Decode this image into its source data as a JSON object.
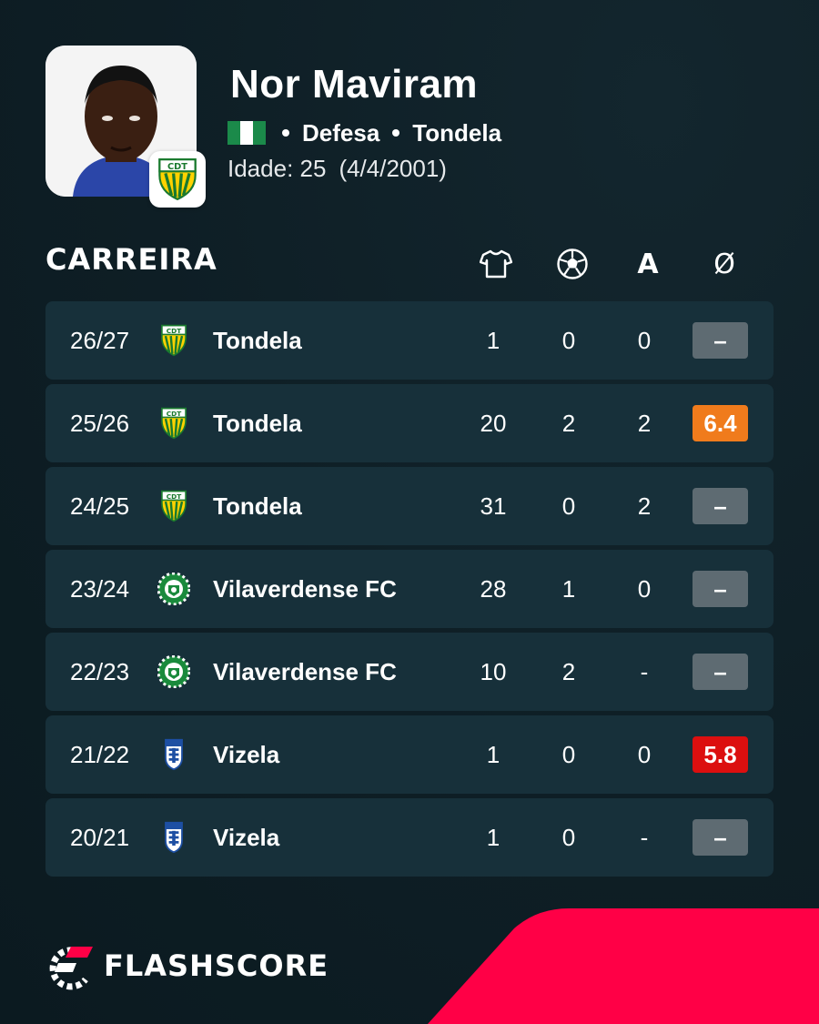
{
  "player": {
    "name": "Nor Maviram",
    "position": "Defesa",
    "team": "Tondela",
    "age_label": "Idade: 25",
    "birthdate": "(4/4/2001)",
    "flag_colors": [
      "#1b8a4a",
      "#ffffff",
      "#1b8a4a"
    ]
  },
  "career": {
    "title": "CARREIRA",
    "columns": {
      "appearances_icon": "shirt-icon",
      "goals_icon": "ball-icon",
      "assists_label": "A",
      "rating_label": "Ø"
    },
    "rows": [
      {
        "season": "26/27",
        "club": "Tondela",
        "logo": "tondela",
        "apps": "1",
        "goals": "0",
        "assists": "0",
        "rating": "–",
        "rating_color": "#5e6b72"
      },
      {
        "season": "25/26",
        "club": "Tondela",
        "logo": "tondela",
        "apps": "20",
        "goals": "2",
        "assists": "2",
        "rating": "6.4",
        "rating_color": "#f07b1c"
      },
      {
        "season": "24/25",
        "club": "Tondela",
        "logo": "tondela",
        "apps": "31",
        "goals": "0",
        "assists": "2",
        "rating": "–",
        "rating_color": "#5e6b72"
      },
      {
        "season": "23/24",
        "club": "Vilaverdense FC",
        "logo": "vilaverdense",
        "apps": "28",
        "goals": "1",
        "assists": "0",
        "rating": "–",
        "rating_color": "#5e6b72"
      },
      {
        "season": "22/23",
        "club": "Vilaverdense FC",
        "logo": "vilaverdense",
        "apps": "10",
        "goals": "2",
        "assists": "-",
        "rating": "–",
        "rating_color": "#5e6b72"
      },
      {
        "season": "21/22",
        "club": "Vizela",
        "logo": "vizela",
        "apps": "1",
        "goals": "0",
        "assists": "0",
        "rating": "5.8",
        "rating_color": "#dc0f0f"
      },
      {
        "season": "20/21",
        "club": "Vizela",
        "logo": "vizela",
        "apps": "1",
        "goals": "0",
        "assists": "-",
        "rating": "–",
        "rating_color": "#5e6b72"
      }
    ]
  },
  "footer": {
    "brand": "FLASHSCORE",
    "accent_color": "#ff0046"
  }
}
